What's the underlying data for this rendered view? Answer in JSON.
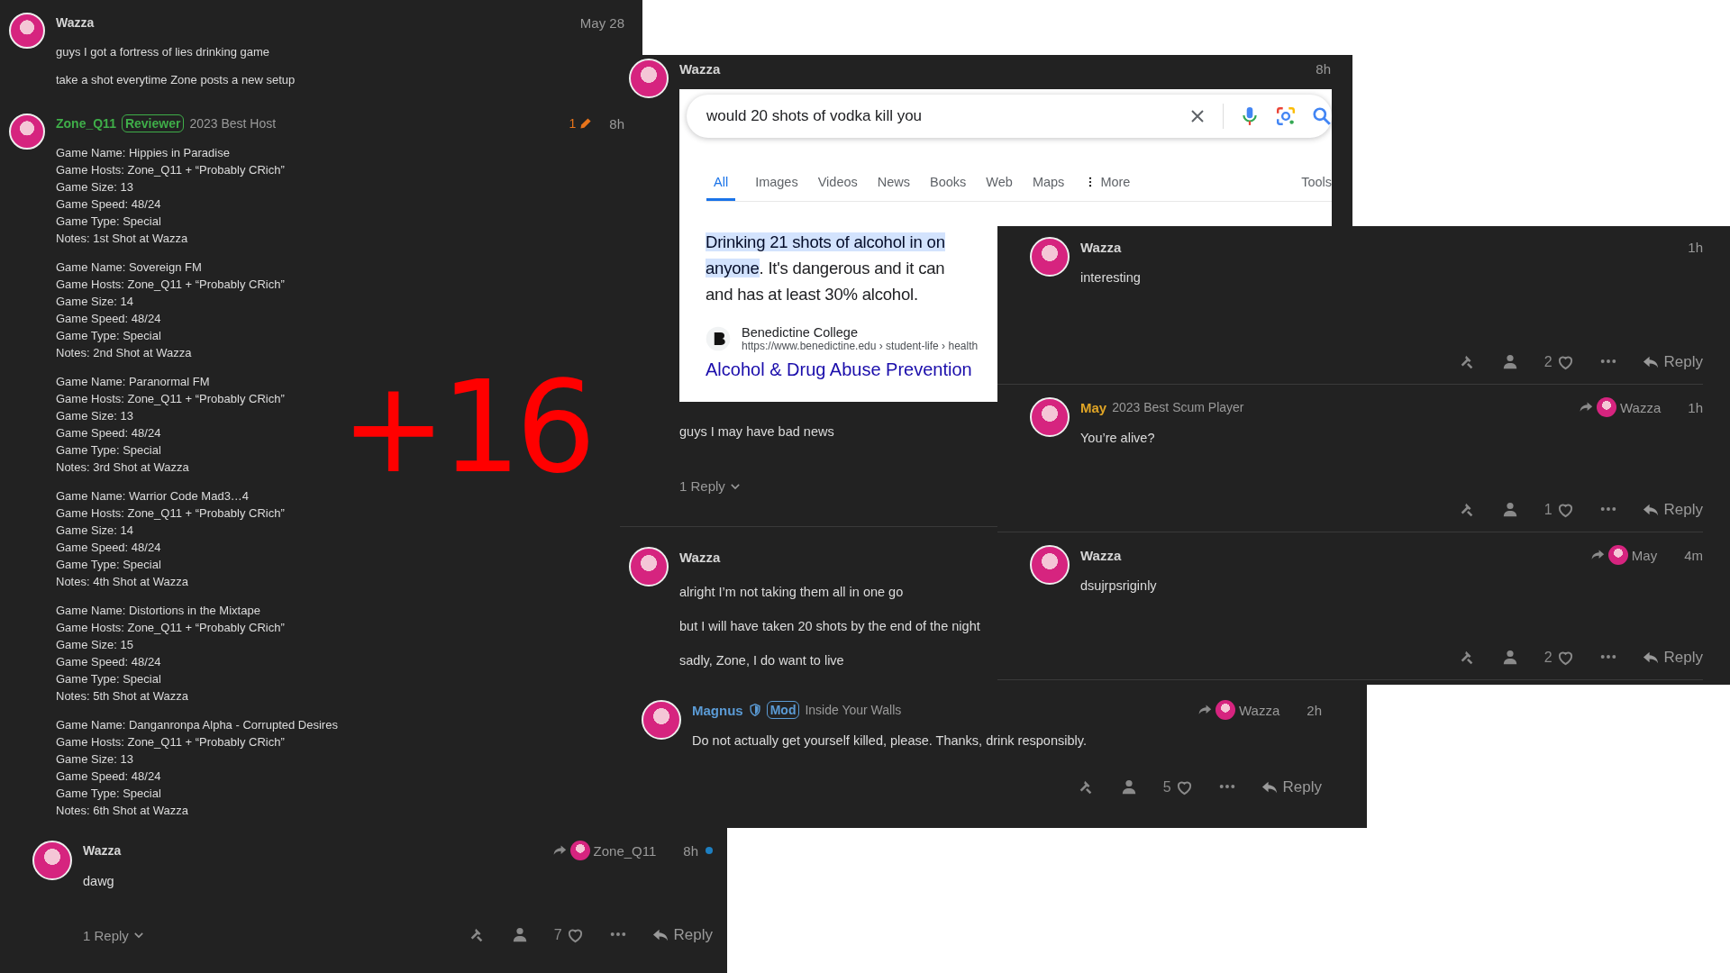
{
  "panels": [
    {
      "kind": "thread",
      "posts": [
        {
          "author": {
            "name": "Wazza",
            "color": "#d6d6d6"
          },
          "time": "May 28",
          "paragraphs": [
            "guys I got a fortress of lies drinking game",
            "take a shot everytime Zone posts a new setup"
          ]
        },
        {
          "author": {
            "name": "Zone_Q11",
            "color": "#3fae49"
          },
          "flair": {
            "label": "Reviewer",
            "color": "#3fae49"
          },
          "title": "2023 Best Host",
          "edits": "1",
          "time": "8h",
          "blocks": [
            [
              "Game Name: Hippies in Paradise",
              "Game Hosts: Zone_Q11 + “Probably CRich”",
              "Game Size: 13",
              "Game Speed: 48/24",
              "Game Type: Special",
              "Notes: 1st Shot at Wazza"
            ],
            [
              "Game Name: Sovereign FM",
              "Game Hosts: Zone_Q11 + “Probably CRich”",
              "Game Size: 14",
              "Game Speed: 48/24",
              "Game Type: Special",
              "Notes: 2nd Shot at Wazza"
            ],
            [
              "Game Name: Paranormal FM",
              "Game Hosts: Zone_Q11 + “Probably CRich”",
              "Game Size: 13",
              "Game Speed: 48/24",
              "Game Type: Special",
              "Notes: 3rd Shot at Wazza"
            ],
            [
              "Game Name: Warrior Code Mad3…4",
              "Game Hosts: Zone_Q11 + “Probably CRich”",
              "Game Size: 14",
              "Game Speed: 48/24",
              "Game Type: Special",
              "Notes: 4th Shot at Wazza"
            ],
            [
              "Game Name: Distortions in the Mixtape",
              "Game Hosts: Zone_Q11 + “Probably CRich”",
              "Game Size: 15",
              "Game Speed: 48/24",
              "Game Type: Special",
              "Notes: 5th Shot at Wazza"
            ],
            [
              "Game Name: Danganronpa Alpha - Corrupted Desires",
              "Game Hosts: Zone_Q11 + “Probably CRich”",
              "Game Size: 13",
              "Game Speed: 48/24",
              "Game Type: Special",
              "Notes: 6th Shot at Wazza"
            ]
          ]
        }
      ]
    },
    {
      "kind": "thread",
      "posts": [
        {
          "author": {
            "name": "Wazza",
            "color": "#d6d6d6"
          },
          "time": "8h",
          "embed": {
            "query": "would 20 shots of vodka kill you",
            "tabs": [
              {
                "label": "All",
                "selected": true
              },
              {
                "label": "Images",
                "selected": false
              },
              {
                "label": "Videos",
                "selected": false
              },
              {
                "label": "News",
                "selected": false
              },
              {
                "label": "Books",
                "selected": false
              },
              {
                "label": "Web",
                "selected": false
              },
              {
                "label": "Maps",
                "selected": false
              },
              {
                "label": "More",
                "selected": false
              }
            ],
            "tools": "Tools",
            "snippet": [
              {
                "highlighted": "Drinking 21 shots of alcohol in on"
              },
              {
                "highlighted": "anyone",
                "rest": ". It's dangerous and it can"
              },
              {
                "rest": "and has at least 30% alcohol."
              }
            ],
            "site": "Benedictine College",
            "url": "https://www.benedictine.edu › student-life › health",
            "link": "Alcohol & Drug Abuse Prevention"
          },
          "paragraphs": [
            "guys I may have bad news"
          ],
          "footer": {
            "replies": "1 Reply"
          }
        },
        {
          "author": {
            "name": "Wazza",
            "color": "#d6d6d6"
          },
          "paragraphs": [
            "alright I’m not taking them all in one go",
            "but I will have taken 20 shots by the end of the night",
            "sadly, Zone, I do want to live"
          ]
        }
      ]
    },
    {
      "kind": "thread",
      "posts": [
        {
          "author": {
            "name": "Magnus",
            "color": "#5b9bd5"
          },
          "shield": true,
          "flair": {
            "label": "Mod",
            "color": "#5b9bd5"
          },
          "title": "Inside Your Walls",
          "reply_to": "Wazza",
          "time": "2h",
          "paragraphs": [
            "Do not actually get yourself killed, please. Thanks, drink responsibly."
          ],
          "footer": {
            "likes": "5",
            "reply": "Reply"
          }
        }
      ]
    },
    {
      "kind": "thread",
      "posts": [
        {
          "author": {
            "name": "Wazza",
            "color": "#d6d6d6"
          },
          "time": "1h",
          "paragraphs": [
            "interesting"
          ],
          "footer": {
            "likes": "2",
            "reply": "Reply"
          }
        },
        {
          "author": {
            "name": "May",
            "color": "#e0a526"
          },
          "title": "2023 Best Scum Player",
          "reply_to": "Wazza",
          "time": "1h",
          "paragraphs": [
            "You’re alive?"
          ],
          "footer": {
            "likes": "1",
            "reply": "Reply"
          }
        },
        {
          "author": {
            "name": "Wazza",
            "color": "#d6d6d6"
          },
          "reply_to": "May",
          "time": "4m",
          "paragraphs": [
            "dsujrpsriginly"
          ],
          "footer": {
            "likes": "2",
            "reply": "Reply"
          }
        }
      ]
    },
    {
      "kind": "thread",
      "posts": [
        {
          "author": {
            "name": "Wazza",
            "color": "#d6d6d6"
          },
          "reply_to": "Zone_Q11",
          "time": "8h",
          "unread": true,
          "paragraphs": [
            "dawg"
          ],
          "footer": {
            "replies": "1 Reply",
            "likes": "7",
            "reply": "Reply"
          }
        }
      ]
    }
  ],
  "annotation": {
    "text": "+16",
    "color": "#ff0000"
  }
}
